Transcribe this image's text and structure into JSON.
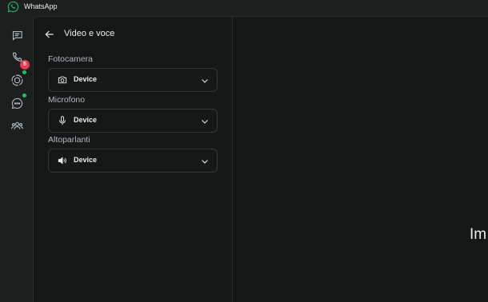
{
  "app": {
    "title": "WhatsApp",
    "accent": "#21c063",
    "badge_color": "#ea3b52"
  },
  "rail": {
    "items": [
      {
        "icon": "chats-icon"
      },
      {
        "icon": "calls-icon",
        "badge": "5"
      },
      {
        "icon": "status-icon",
        "dot": true
      },
      {
        "icon": "channels-icon",
        "dot": true
      },
      {
        "icon": "communities-icon"
      }
    ]
  },
  "settings": {
    "title": "Video e voce",
    "sections": [
      {
        "label": "Fotocamera",
        "value": "Device",
        "icon": "camera-icon"
      },
      {
        "label": "Microfono",
        "value": "Device",
        "icon": "microphone-icon"
      },
      {
        "label": "Altoparlanti",
        "value": "Device",
        "icon": "speaker-icon"
      }
    ]
  },
  "main": {
    "text": "Im"
  }
}
